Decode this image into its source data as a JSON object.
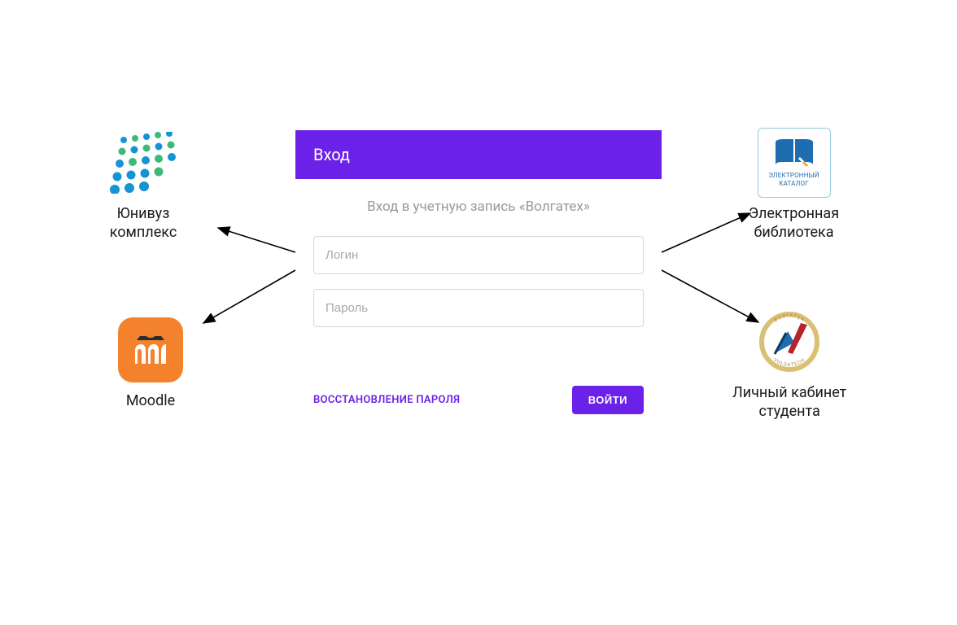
{
  "login": {
    "title": "Вход",
    "subtitle": "Вход в учетную запись «Волгатех»",
    "login_placeholder": "Логин",
    "password_placeholder": "Пароль",
    "recover_label": "ВОССТАНОВЛЕНИЕ ПАРОЛЯ",
    "button_label": "ВОЙТИ"
  },
  "services": {
    "univuz": {
      "label_line1": "Юнивуз",
      "label_line2": "комплекс"
    },
    "moodle": {
      "label": "Moodle"
    },
    "elib": {
      "label_line1": "Электронная",
      "label_line2": "библиотека",
      "icon_text_line1": "ЭЛЕКТРОННЫЙ",
      "icon_text_line2": "КАТАЛОГ"
    },
    "lk": {
      "label_line1": "Личный кабинет",
      "label_line2": "студента",
      "badge_top": "ВОЛГАТЕХ",
      "badge_bottom": "VOLGATECH"
    }
  },
  "colors": {
    "primary": "#6b21e8",
    "moodle_orange": "#f4812c",
    "univuz_blue": "#1594d5",
    "univuz_green": "#3fb979"
  }
}
